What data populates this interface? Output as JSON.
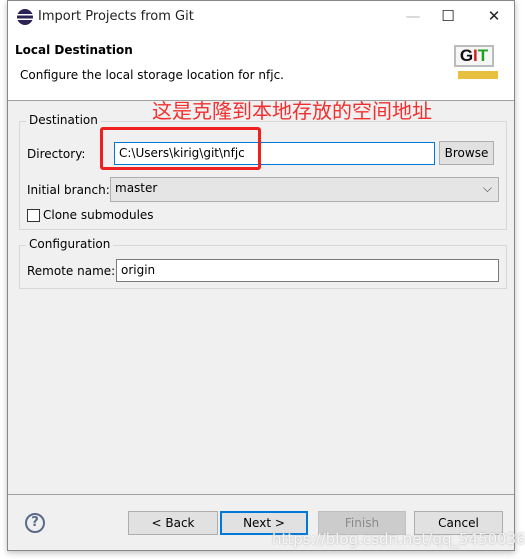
{
  "window": {
    "title": "Import Projects from Git",
    "minimize": "—",
    "maximize": "☐",
    "close": "✕",
    "app_icon": "eclipse-icon"
  },
  "header": {
    "title": "Local Destination",
    "description": "Configure the local storage location for nfjc.",
    "logo_text": "GIT"
  },
  "annotation": "这是克隆到本地存放的空间地址",
  "destination": {
    "group_label": "Destination",
    "directory_label": "Directory:",
    "directory_value": "C:\\Users\\kirig\\git\\nfjc",
    "browse": "Browse",
    "branch_label": "Initial branch:",
    "branch_value": "master",
    "clone_submodules": "Clone submodules",
    "clone_submodules_checked": false
  },
  "configuration": {
    "group_label": "Configuration",
    "remote_label": "Remote name:",
    "remote_value": "origin"
  },
  "buttons": {
    "back": "< Back",
    "next": "Next >",
    "finish": "Finish",
    "cancel": "Cancel",
    "help": "?"
  },
  "watermark": "https://blog.csdn.net/qq_54500361"
}
